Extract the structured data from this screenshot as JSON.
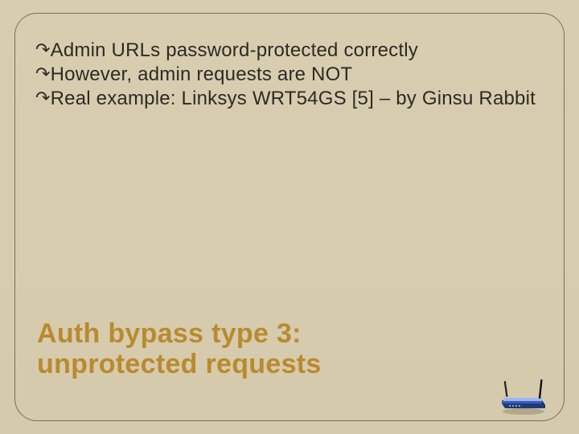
{
  "bullets": {
    "b0": "Admin URLs password-protected correctly",
    "b1": "However, admin requests are NOT",
    "b2": "Real example: Linksys WRT54GS [5] – by Ginsu Rabbit"
  },
  "title_line1": "Auth bypass type 3:",
  "title_line2": "unprotected requests",
  "icon_name": "router-icon"
}
